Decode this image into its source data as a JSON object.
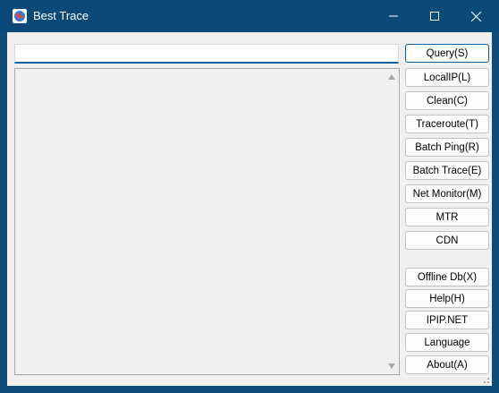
{
  "window": {
    "title": "Best Trace",
    "controls": {
      "minimize": "—",
      "maximize": "☐",
      "close": "✕"
    },
    "accent": "#0b4a78"
  },
  "query": {
    "value": ""
  },
  "buttons": [
    {
      "id": "query",
      "label": "Query(S)",
      "primary": true
    },
    {
      "id": "localip",
      "label": "LocalIP(L)"
    },
    {
      "id": "clean",
      "label": "Clean(C)"
    },
    {
      "id": "traceroute",
      "label": "Traceroute(T)"
    },
    {
      "id": "batch-ping",
      "label": "Batch Ping(R)"
    },
    {
      "id": "batch-trace",
      "label": "Batch Trace(E)"
    },
    {
      "id": "net-monitor",
      "label": "Net Monitor(M)"
    },
    {
      "id": "mtr",
      "label": "MTR"
    },
    {
      "id": "cdn",
      "label": "CDN"
    },
    {
      "id": "offline-db",
      "label": "Offline Db(X)"
    },
    {
      "id": "help",
      "label": "Help(H)"
    },
    {
      "id": "ipip",
      "label": "IPIP.NET"
    },
    {
      "id": "language",
      "label": "Language"
    },
    {
      "id": "about",
      "label": "About(A)"
    }
  ]
}
